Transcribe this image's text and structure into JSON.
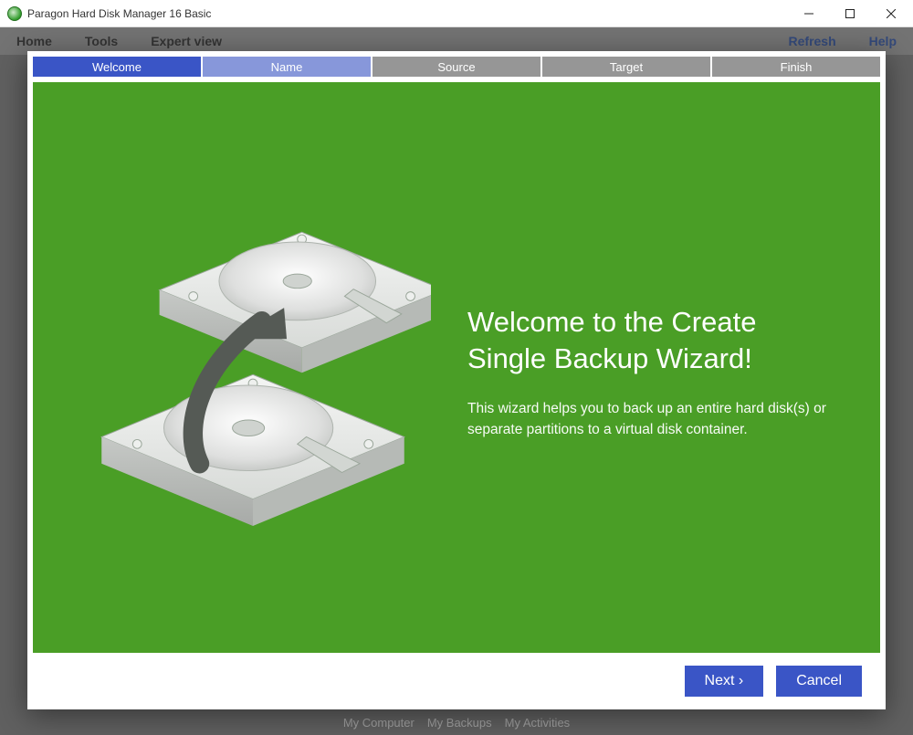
{
  "window": {
    "title": "Paragon Hard Disk Manager 16 Basic"
  },
  "background_menu": {
    "home": "Home",
    "tools": "Tools",
    "expert": "Expert view",
    "refresh": "Refresh",
    "help": "Help"
  },
  "background_footer": {
    "a": "My Computer",
    "b": "My Backups",
    "c": "My Activities"
  },
  "wizard": {
    "steps": {
      "welcome": "Welcome",
      "name": "Name",
      "source": "Source",
      "target": "Target",
      "finish": "Finish"
    },
    "heading": "Welcome to the Create Single Backup Wizard!",
    "body": "This wizard helps you to back up an entire hard disk(s) or separate partitions to a virtual disk container.",
    "buttons": {
      "next": "Next ›",
      "cancel": "Cancel"
    }
  }
}
